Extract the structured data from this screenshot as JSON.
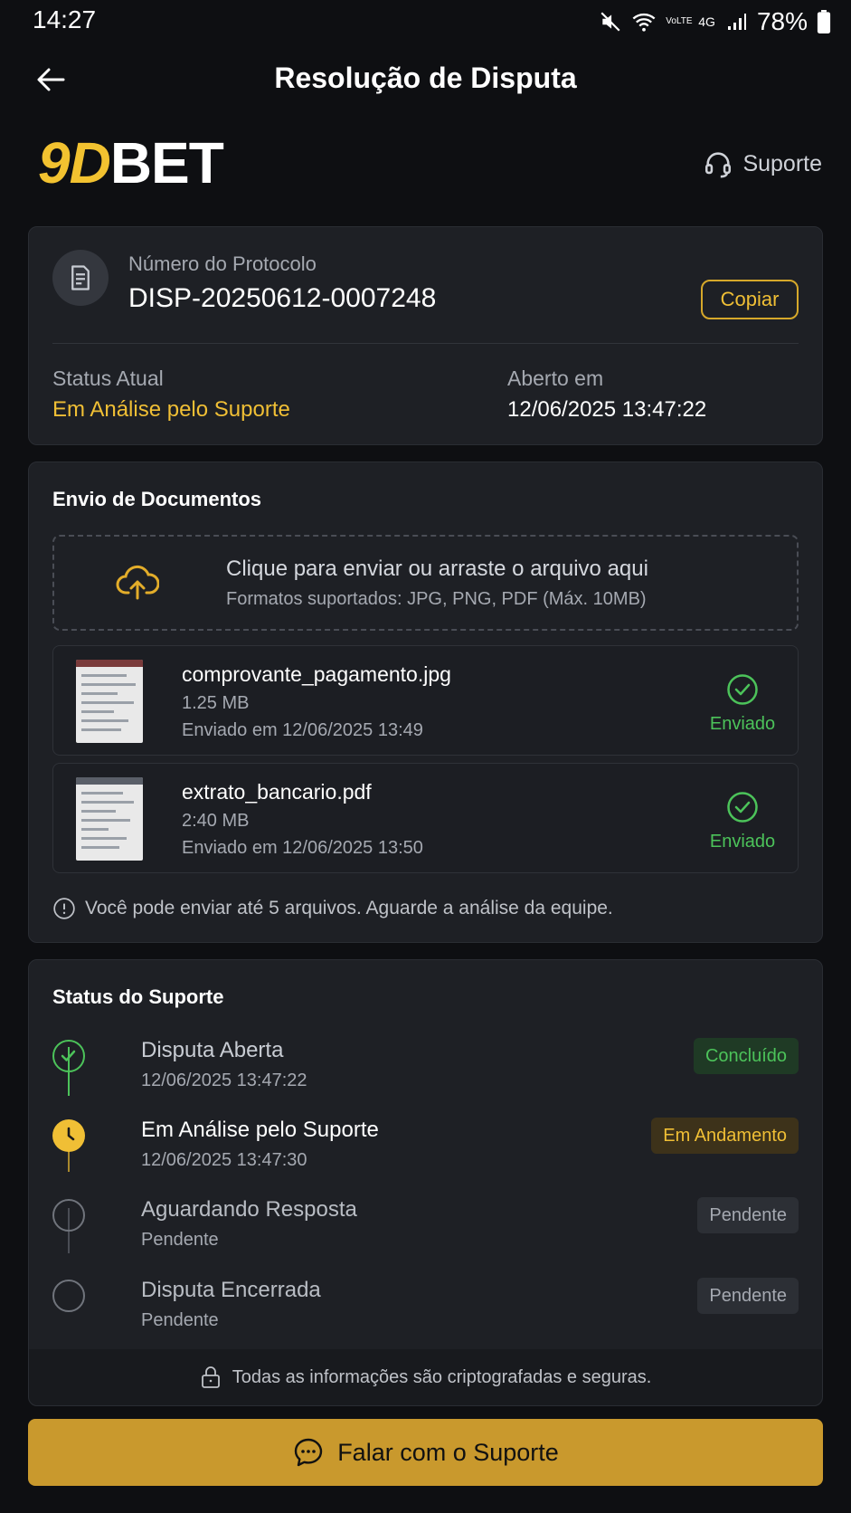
{
  "status_bar": {
    "time": "14:27",
    "network_label_1": "VoLTE",
    "network_label_2": "4G",
    "battery": "78%"
  },
  "header": {
    "title": "Resolução de Disputa",
    "back_icon": "arrow-left-icon"
  },
  "brand": {
    "logo_part1": "9D",
    "logo_part2": "BET",
    "support_label": "Suporte",
    "accent_color": "#f2c230"
  },
  "protocol": {
    "label": "Número do Protocolo",
    "value": "DISP-20250612-0007248",
    "copy_label": "Copiar",
    "status_label": "Status Atual",
    "status_value": "Em Análise pelo Suporte",
    "opened_label": "Aberto em",
    "opened_value": "12/06/2025 13:47:22"
  },
  "documents": {
    "title": "Envio de Documentos",
    "dropzone_title": "Clique para enviar ou arraste o arquivo aqui",
    "dropzone_sub": "Formatos suportados: JPG, PNG, PDF (Máx. 10MB)",
    "files": [
      {
        "name": "comprovante_pagamento.jpg",
        "size": "1.25 MB",
        "date": "Enviado em 12/06/2025 13:49",
        "status": "Enviado"
      },
      {
        "name": "extrato_bancario.pdf",
        "size": "2:40 MB",
        "date": "Enviado em 12/06/2025 13:50",
        "status": "Enviado"
      }
    ],
    "note": "Você pode enviar até 5 arquivos. Aguarde a análise da equipe."
  },
  "support_status": {
    "title": "Status do Suporte",
    "steps": [
      {
        "title": "Disputa Aberta",
        "date": "12/06/2025 13:47:22",
        "badge": "Concluído",
        "state": "done"
      },
      {
        "title": "Em Análise pelo Suporte",
        "date": "12/06/2025 13:47:30",
        "badge": "Em Andamento",
        "state": "active"
      },
      {
        "title": "Aguardando Resposta",
        "date": "Pendente",
        "badge": "Pendente",
        "state": "pending"
      },
      {
        "title": "Disputa Encerrada",
        "date": "Pendente",
        "badge": "Pendente",
        "state": "pending"
      }
    ],
    "secure_note": "Todas as informações são criptografadas e seguras."
  },
  "cta": {
    "label": "Falar com o Suporte"
  },
  "colors": {
    "success": "#4cc35a",
    "warning": "#f0bf35",
    "pending": "#9aa0a8",
    "cta": "#c9992d"
  }
}
